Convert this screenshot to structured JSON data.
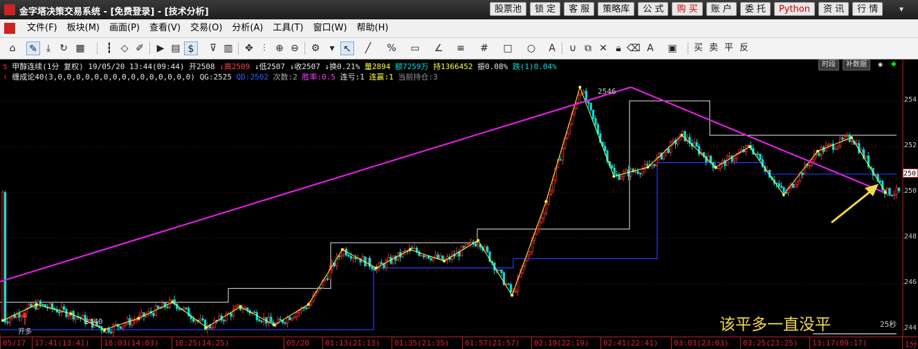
{
  "window": {
    "title": "金字塔决策交易系统 - [免费登录] - [技术分析]",
    "buttons": [
      "股票池",
      "锁 定",
      "客 服",
      "策略库",
      "公 式",
      "购 买",
      "账 户",
      "委 托",
      "Python",
      "资 讯",
      "行 情"
    ],
    "red_buttons": [
      "购 买",
      "Python"
    ]
  },
  "menu": [
    "文件(F)",
    "板块(M)",
    "画面(P)",
    "查看(V)",
    "交易(O)",
    "分析(A)",
    "工具(T)",
    "窗口(W)",
    "帮助(H)"
  ],
  "toolbar": {
    "trade_labels": [
      "买",
      "卖",
      "平",
      "反"
    ]
  },
  "quote_line": {
    "symbol": "甲醇连续(1分 复权)",
    "datetime": "19/05/20 13:44(09:44)",
    "open": "开2508",
    "high": "↓高2509",
    "low": "↓低2507",
    "close": "↓收2507",
    "turnover": "↓换0.21%",
    "volume": "量2894",
    "amount": "额7259万",
    "position": "持1366452",
    "amplitude": "振0.08%",
    "change": "跌(1)0.04%"
  },
  "indicator_line": {
    "name": "缠成论40(3,0,0,0,0,0,0,0,0,0,0,0,0,0,0,0)",
    "qg": "QG:2525",
    "qd": "QD:2502",
    "times": "次数:2",
    "win_rate": "胜率:0.5",
    "loss_streak": "连亏:1",
    "win_streak": "连赢:1",
    "current_position": "当前持仓:3"
  },
  "chart_buttons": [
    "时段",
    "补数据"
  ],
  "chart": {
    "y_labels": [
      "254",
      "252",
      "250",
      "248",
      "246",
      "244"
    ],
    "current_price_badge": "250",
    "peak_label": "2546",
    "low_label": "2440",
    "open_long_label": "开多",
    "countdown_label": "25秒",
    "annotation": "该平多一直没平"
  },
  "time_axis": [
    "05/17",
    "17:41(13:41)",
    "18:03(14:03)",
    "18:25(14:25)",
    "05/20",
    "01:13(21:13)",
    "01:35(21:35)",
    "01:57(21:57)",
    "02:19(22:19)",
    "02:41(22:41)",
    "03:03(23:03)",
    "03:25(23:25)",
    "13:17(09:17)",
    "1分"
  ],
  "chart_data": {
    "type": "line",
    "title": "",
    "xlabel": "",
    "ylabel": "",
    "series": [
      {
        "values": [
          2444,
          2451,
          2447,
          2440,
          2445,
          2452,
          2441,
          2450,
          2442,
          2451,
          2475,
          2467,
          2475,
          2470,
          2479,
          2455,
          2496,
          2546,
          2507,
          2511,
          2525,
          2511,
          2520,
          2499,
          2518,
          2524,
          2500
        ]
      }
    ],
    "annotated_levels": {
      "peak": 2546,
      "low": 2440,
      "qg": 2525,
      "qd": 2502
    },
    "colors": {
      "trendline": "#e020e0",
      "bi_zigzag": "#ffff40",
      "qg": "#e6e6e6",
      "qd": "#2a3cff",
      "up": "#ff3030",
      "down": "#00e0e0",
      "arrow": "#f2d94a"
    }
  }
}
